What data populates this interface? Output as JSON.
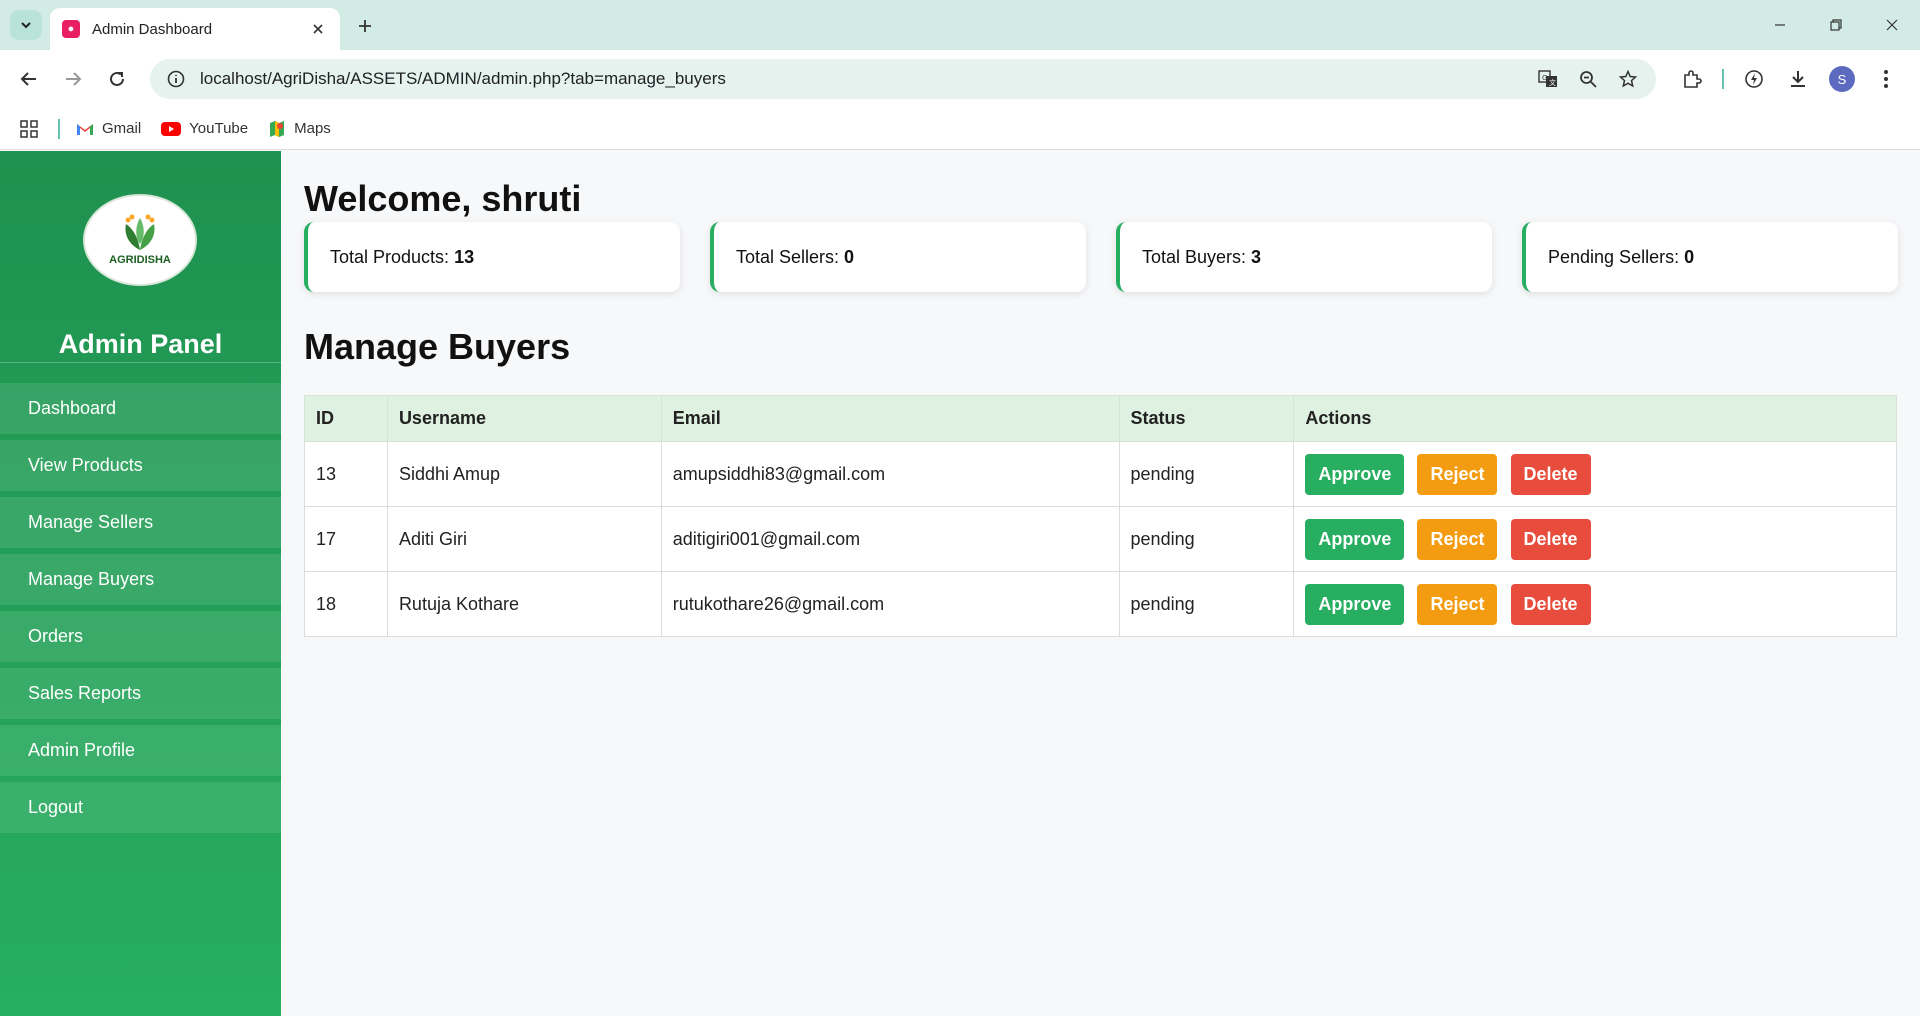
{
  "browser": {
    "tab_title": "Admin Dashboard",
    "url": "localhost/AgriDisha/ASSETS/ADMIN/admin.php?tab=manage_buyers",
    "profile_initial": "S",
    "bookmarks": [
      {
        "label": "Gmail",
        "icon": "gmail-icon"
      },
      {
        "label": "YouTube",
        "icon": "youtube-icon"
      },
      {
        "label": "Maps",
        "icon": "maps-icon"
      }
    ]
  },
  "sidebar": {
    "logo_text": "AGRIDISHA",
    "title": "Admin Panel",
    "items": [
      {
        "label": "Dashboard"
      },
      {
        "label": "View Products"
      },
      {
        "label": "Manage Sellers"
      },
      {
        "label": "Manage Buyers"
      },
      {
        "label": "Orders"
      },
      {
        "label": "Sales Reports"
      },
      {
        "label": "Admin Profile"
      },
      {
        "label": "Logout"
      }
    ]
  },
  "main": {
    "welcome": "Welcome, shruti",
    "stats": [
      {
        "label": "Total Products:",
        "value": "13"
      },
      {
        "label": "Total Sellers:",
        "value": "0"
      },
      {
        "label": "Total Buyers:",
        "value": "3"
      },
      {
        "label": "Pending Sellers:",
        "value": "0"
      }
    ],
    "section_title": "Manage Buyers",
    "table": {
      "headers": [
        "ID",
        "Username",
        "Email",
        "Status",
        "Actions"
      ],
      "rows": [
        {
          "id": "13",
          "username": "Siddhi Amup",
          "email": "amupsiddhi83@gmail.com",
          "status": "pending"
        },
        {
          "id": "17",
          "username": "Aditi Giri",
          "email": "aditigiri001@gmail.com",
          "status": "pending"
        },
        {
          "id": "18",
          "username": "Rutuja Kothare",
          "email": "rutukothare26@gmail.com",
          "status": "pending"
        }
      ],
      "actions": {
        "approve": "Approve",
        "reject": "Reject",
        "delete": "Delete"
      }
    }
  },
  "colors": {
    "sidebar_green": "#1f9150",
    "approve": "#27ae60",
    "reject": "#f39c12",
    "delete": "#e74c3c",
    "table_header": "#dff1e0"
  }
}
